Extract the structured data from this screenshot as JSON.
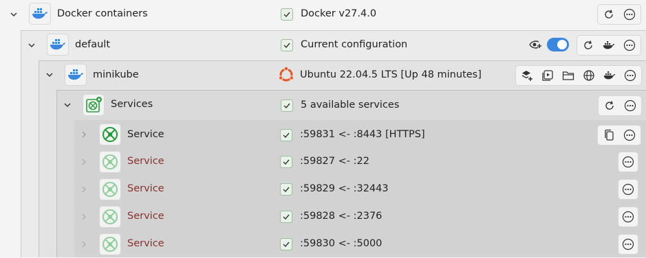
{
  "rows": {
    "docker": {
      "name": "Docker containers",
      "status": "Docker v27.4.0"
    },
    "default": {
      "name": "default",
      "status": "Current configuration",
      "toggle_on": true
    },
    "minikube": {
      "name": "minikube",
      "status": "Ubuntu 22.04.5 LTS [Up 48 minutes]"
    },
    "services": {
      "name": "Services",
      "status": "5 available services"
    },
    "service_items": [
      {
        "name": "Service",
        "status": ":59831 <- :8443 [HTTPS]"
      },
      {
        "name": "Service",
        "status": ":59827 <- :22"
      },
      {
        "name": "Service",
        "status": ":59829 <- :32443"
      },
      {
        "name": "Service",
        "status": ":59828 <- :2376"
      },
      {
        "name": "Service",
        "status": ":59830 <- :5000"
      }
    ]
  },
  "colors": {
    "docker_blue": "#3a87e0",
    "kube_green": "#2a9d3e",
    "ubuntu_orange": "#e95420",
    "service_text_red": "#8b2f2f"
  },
  "icons": {
    "docker": "docker-whale-icon",
    "kube": "kubernetes-service-icon",
    "check": "check-icon",
    "refresh": "refresh-icon",
    "more": "more-icon",
    "copy": "copy-icon",
    "eye": "visibility-icon"
  }
}
